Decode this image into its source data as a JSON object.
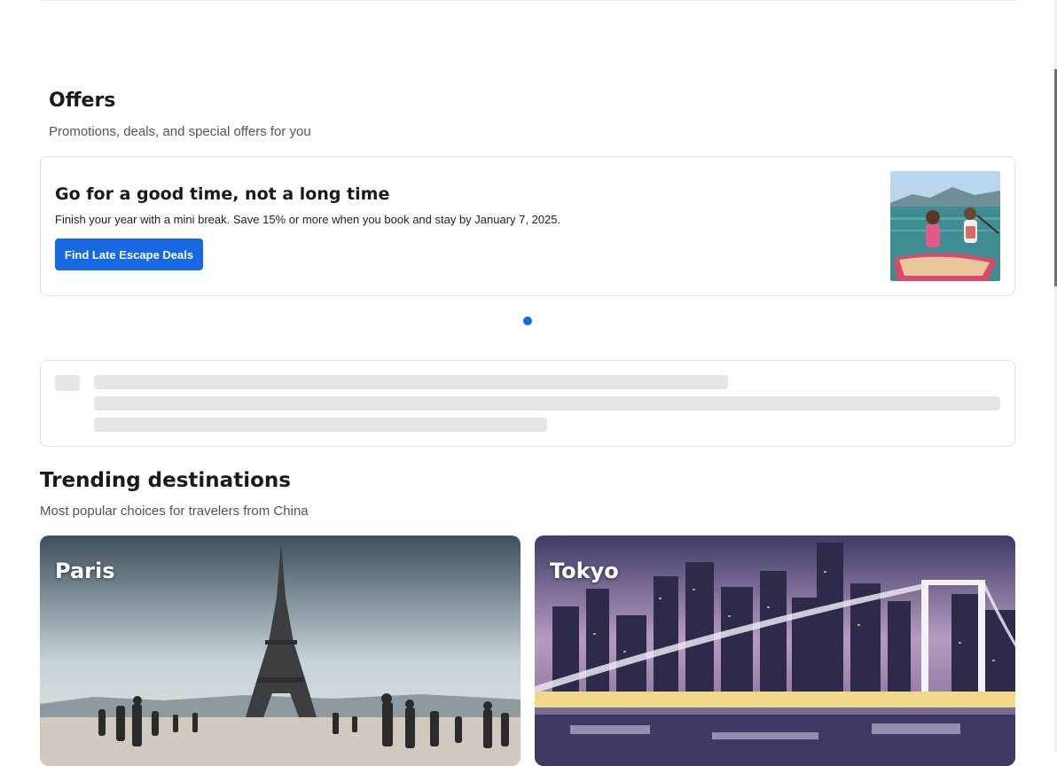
{
  "offers": {
    "title": "Offers",
    "subtitle": "Promotions, deals, and special offers for you",
    "card": {
      "heading": "Go for a good time, not a long time",
      "text": "Finish your year with a mini break. Save 15% or more when you book and stay by January 7, 2025.",
      "button_label": "Find Late Escape Deals"
    },
    "carousel": {
      "active_index": 1,
      "total": 1
    }
  },
  "trending": {
    "title": "Trending destinations",
    "subtitle": "Most popular choices for travelers from China",
    "destinations": [
      {
        "name": "Paris"
      },
      {
        "name": "Tokyo"
      }
    ]
  },
  "colors": {
    "accent": "#1668e3",
    "skeleton": "#e6e6e6",
    "border": "#dfdfdf"
  }
}
